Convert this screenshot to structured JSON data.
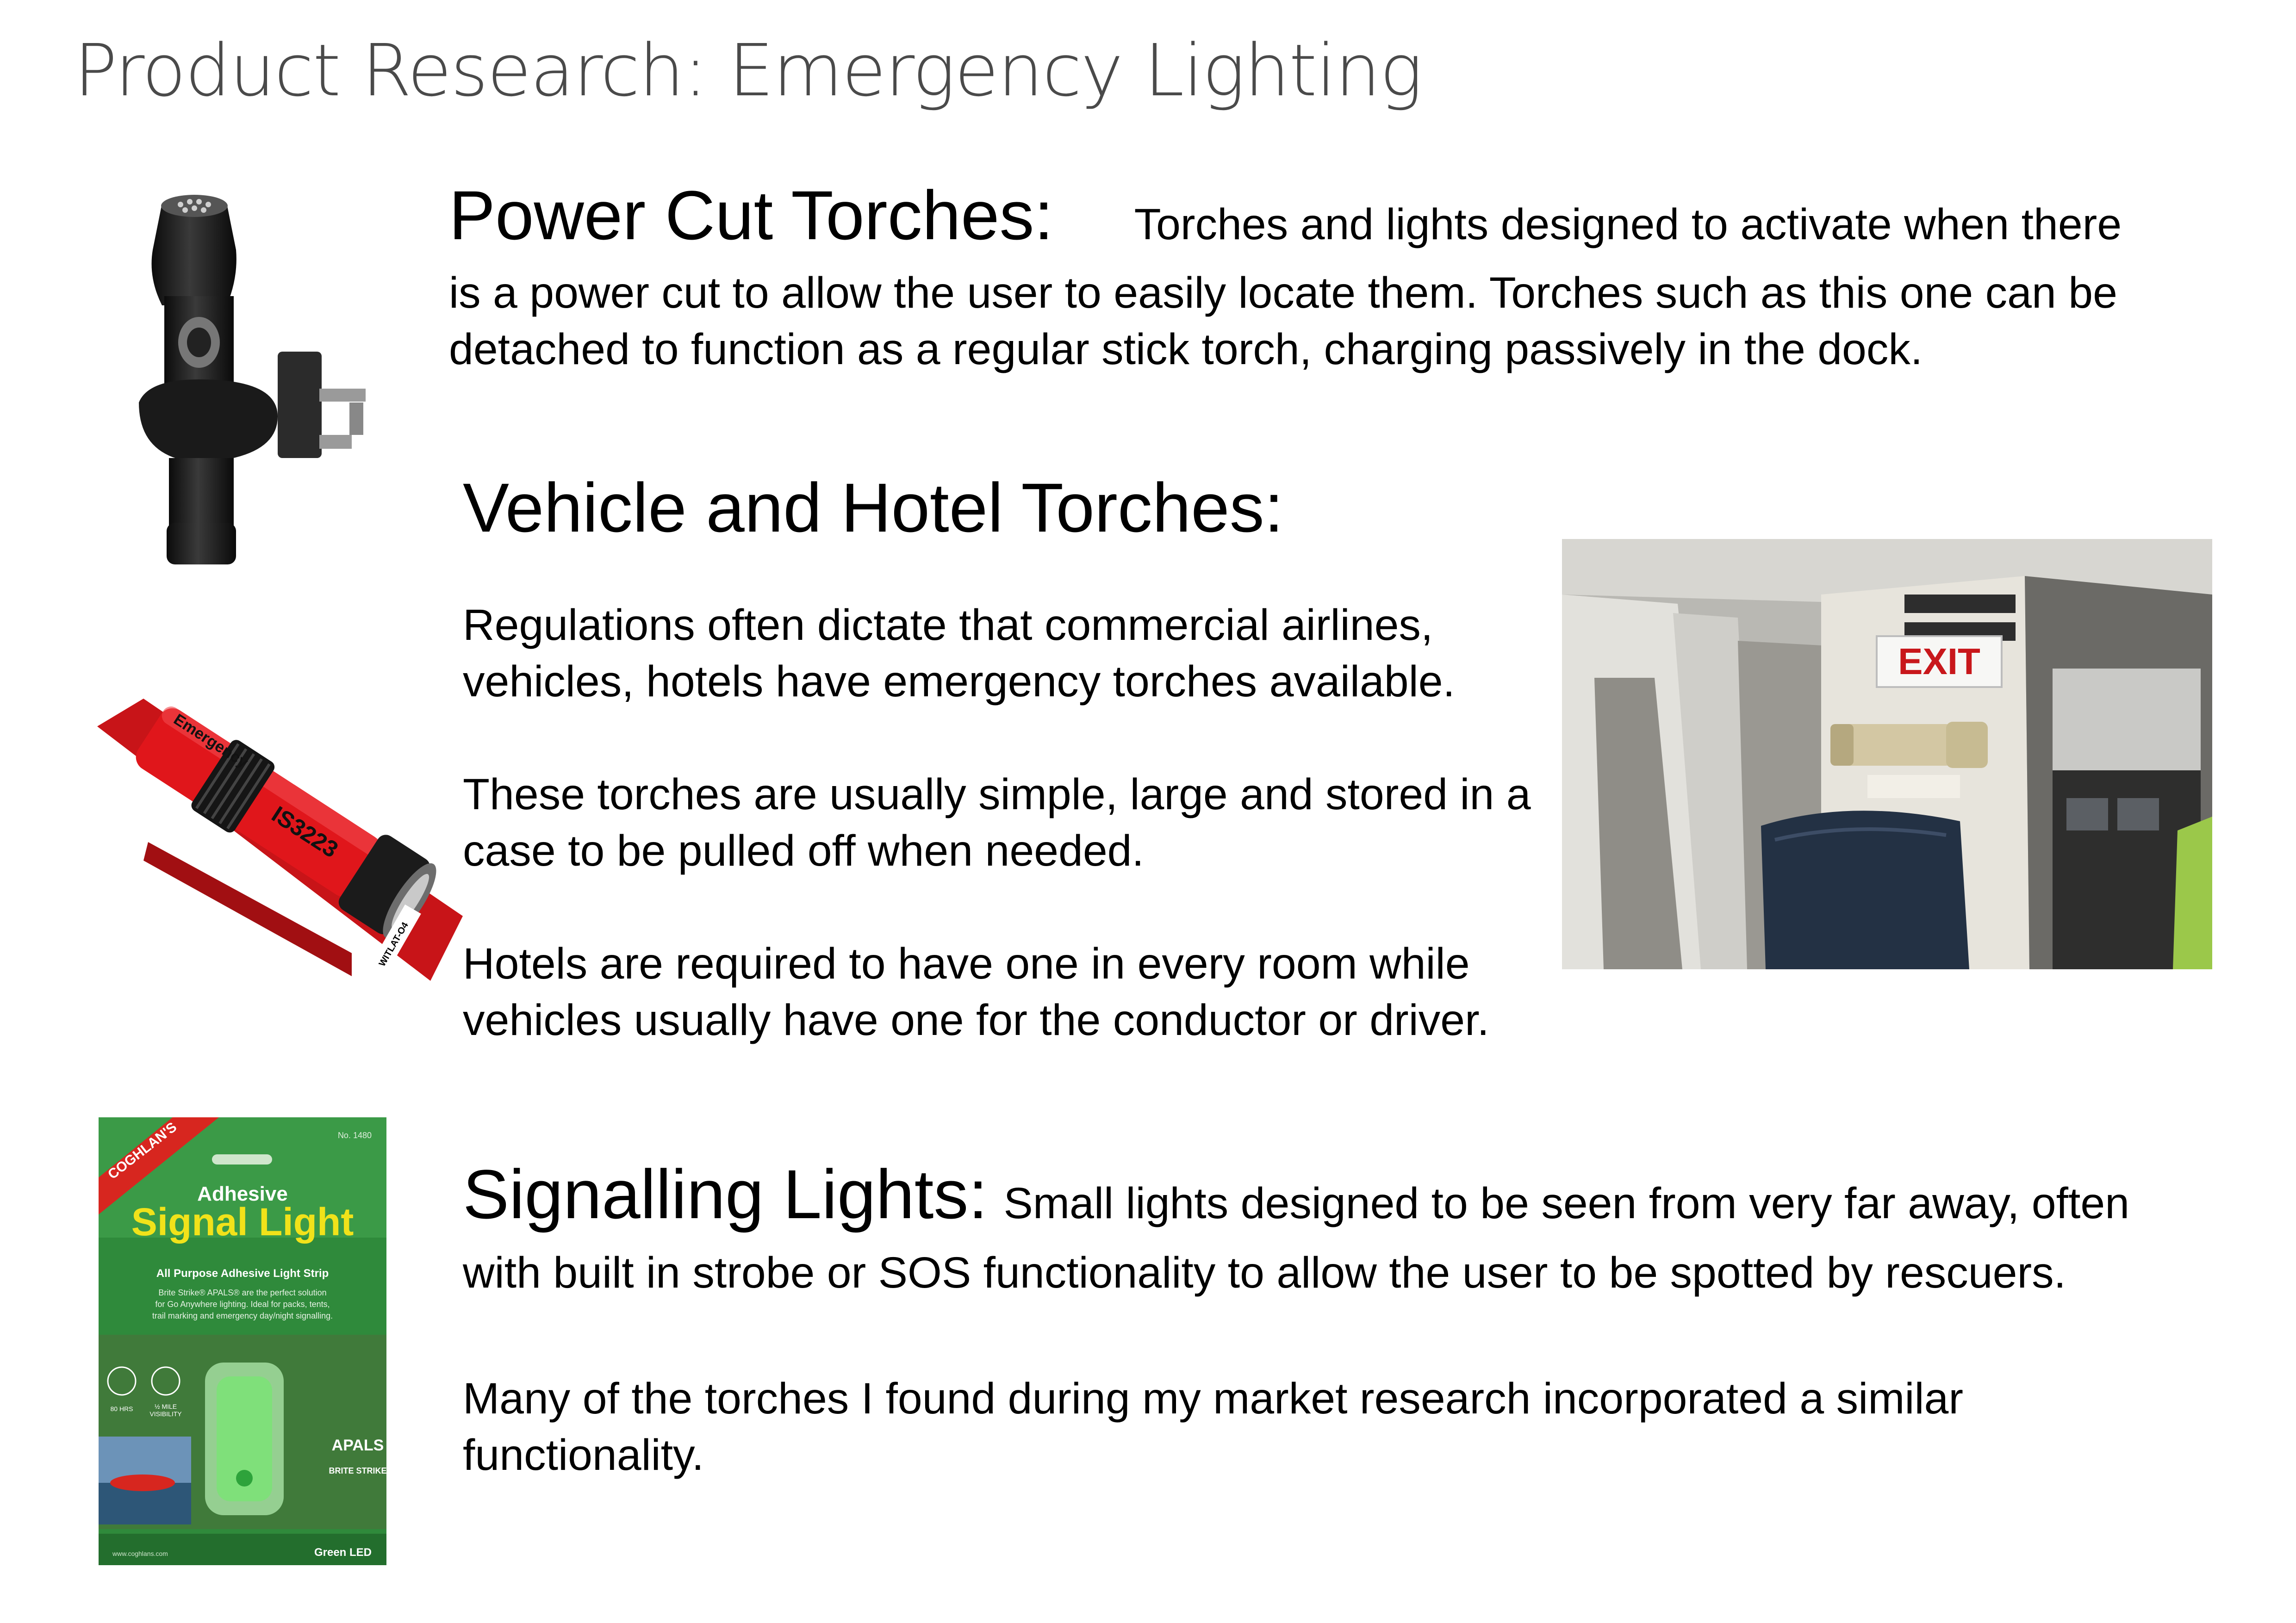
{
  "page": {
    "title": "Product Research: Emergency Lighting"
  },
  "sections": {
    "power_cut": {
      "heading": "Power Cut Torches:",
      "text_first_line": "Torches and lights designed to activate when there",
      "text_rest": "is a power cut to allow the user to easily locate them. Torches such as this one can be detached to function as a regular stick torch, charging passively in the dock."
    },
    "vehicle_hotel": {
      "heading": "Vehicle and Hotel Torches:",
      "paragraphs": [
        "Regulations often dictate that commercial airlines, vehicles, hotels have emergency torches available.",
        "These torches are usually simple, large and stored in a case to be pulled off when needed.",
        "Hotels are required to have one in every room while vehicles usually have one for the conductor or driver."
      ]
    },
    "signalling": {
      "heading": "Signalling Lights:",
      "text_first": "Small lights designed to be seen from very far away, often with built in strobe or SOS functionality to allow the user to be spotted by rescuers.",
      "text_second": "Many of the torches I found during my market research incorporated a similar functionality."
    }
  },
  "images": {
    "red_torch": {
      "brand": "Emergency",
      "code": "IS3223",
      "label": "WITLAT-O4"
    },
    "cabin_photo": {
      "sign": "EXIT"
    },
    "package": {
      "brand": "COGHLAN'S",
      "number": "No. 1480",
      "title_small": "Adhesive",
      "title_big": "Signal Light",
      "subtitle": "All Purpose Adhesive Light Strip",
      "desc_lines": [
        "Brite Strike® APALS® are the perfect solution",
        "for Go Anywhere lighting. Ideal for packs, tents,",
        "trail marking and emergency day/night signalling."
      ],
      "icon1": "80 HRS",
      "icon2a": "½ MILE",
      "icon2b": "VISIBILITY",
      "apals": "APALS",
      "britestrike": "BRITE STRIKE",
      "footer_left": "www.coghlans.com",
      "footer_right": "Green LED"
    }
  },
  "colors": {
    "title_gray": "#4a4a4a",
    "torch_red": "#e0161b",
    "package_green": "#2f8a3b",
    "package_yellow": "#f1e21a"
  }
}
